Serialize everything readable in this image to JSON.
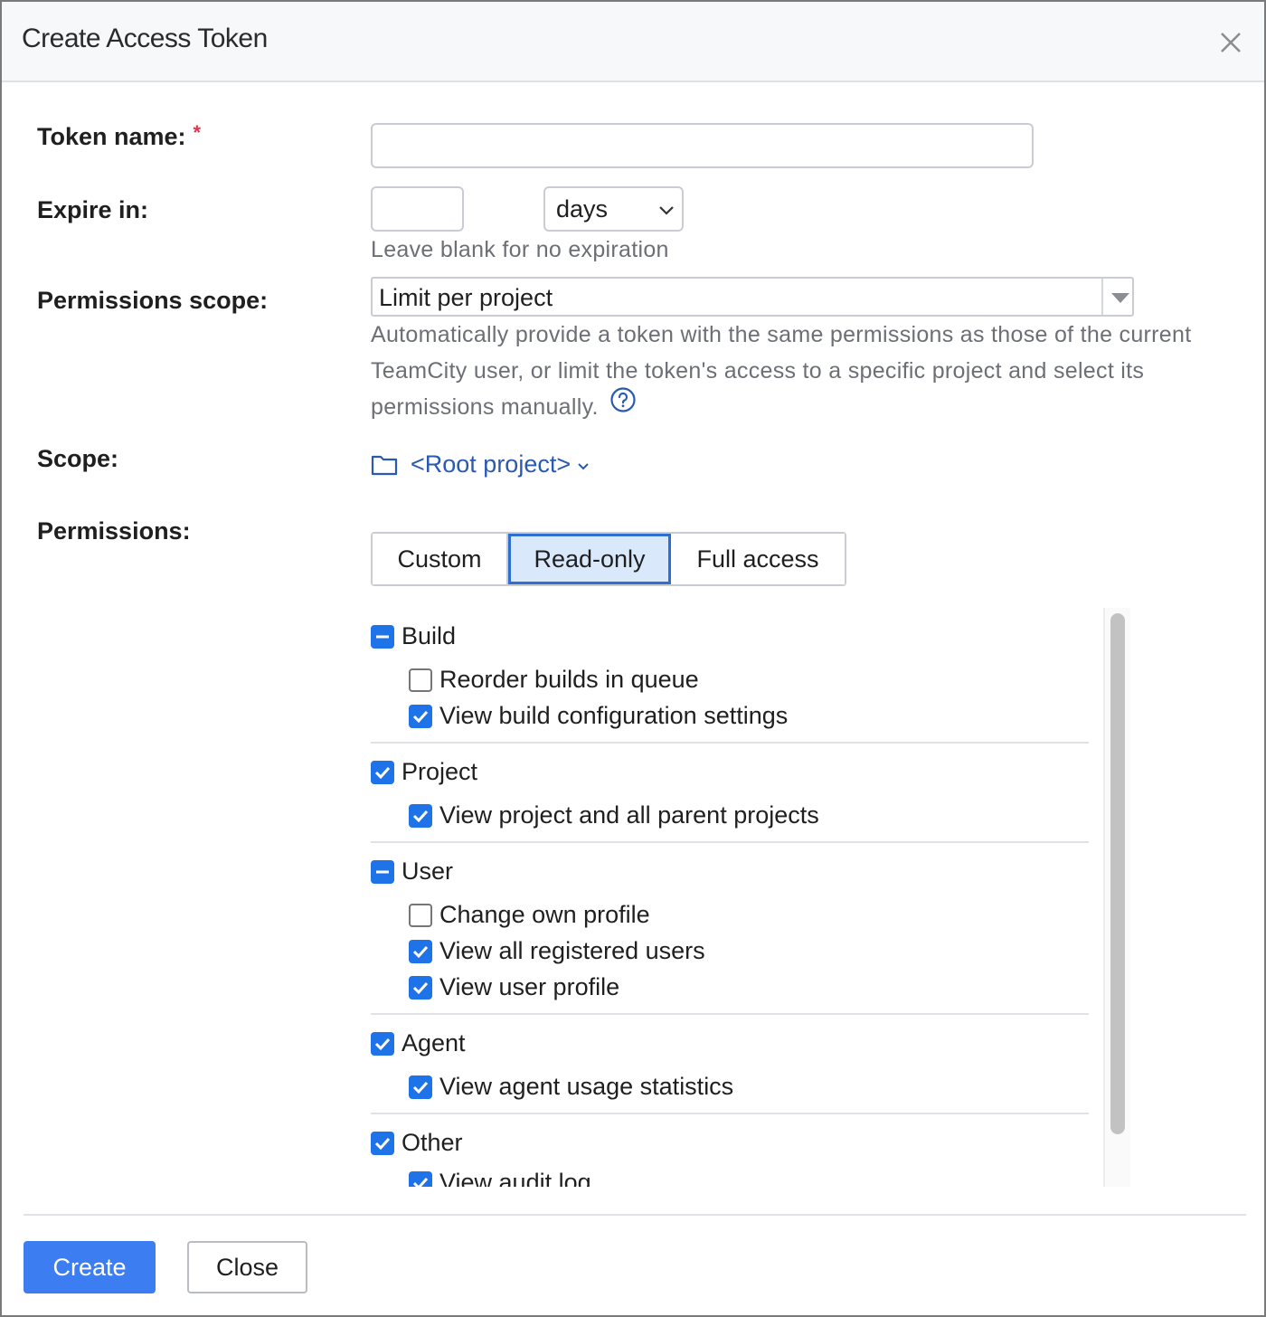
{
  "dialog": {
    "title": "Create Access Token",
    "close_icon": "close-icon"
  },
  "form": {
    "token_name_label": "Token name:",
    "required_mark": "*",
    "token_name_value": "",
    "expire_label": "Expire in:",
    "expire_value": "",
    "expire_unit": "days",
    "expire_hint": "Leave blank for no expiration",
    "permissions_scope_label": "Permissions scope:",
    "permissions_scope_value": "Limit per project",
    "permissions_scope_desc": "Automatically provide a token with the same permissions as those of the current TeamCity user, or limit the token's access to a specific project and select its permissions manually.",
    "scope_label": "Scope:",
    "scope_value": "<Root project>",
    "permissions_label": "Permissions:"
  },
  "permission_modes": {
    "custom": "Custom",
    "read_only": "Read-only",
    "full_access": "Full access",
    "selected": "Read-only"
  },
  "groups": {
    "build": {
      "label": "Build",
      "state": "partial",
      "items": [
        {
          "label": "Reorder builds in queue",
          "checked": false
        },
        {
          "label": "View build configuration settings",
          "checked": true
        }
      ]
    },
    "project": {
      "label": "Project",
      "state": "checked",
      "items": [
        {
          "label": "View project and all parent projects",
          "checked": true
        }
      ]
    },
    "user": {
      "label": "User",
      "state": "partial",
      "items": [
        {
          "label": "Change own profile",
          "checked": false
        },
        {
          "label": "View all registered users",
          "checked": true
        },
        {
          "label": "View user profile",
          "checked": true
        }
      ]
    },
    "agent": {
      "label": "Agent",
      "state": "checked",
      "items": [
        {
          "label": "View agent usage statistics",
          "checked": true
        }
      ]
    },
    "other": {
      "label": "Other",
      "state": "checked",
      "items": [
        {
          "label": "View audit log",
          "checked": true
        }
      ]
    }
  },
  "footer": {
    "create_label": "Create",
    "close_label": "Close"
  },
  "colors": {
    "accent": "#1f73e8",
    "primary_button": "#3d7df2",
    "link": "#2a5ab0",
    "required": "#e0344b"
  }
}
